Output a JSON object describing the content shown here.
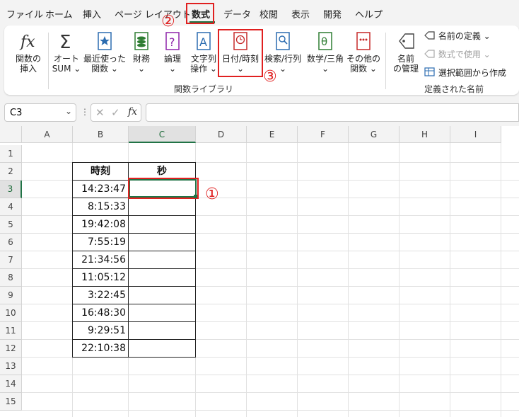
{
  "menu": {
    "tabs": [
      "ファイル",
      "ホーム",
      "挿入",
      "ページ レイアウト",
      "数式",
      "データ",
      "校閲",
      "表示",
      "開発",
      "ヘルプ"
    ],
    "active_tab": "数式"
  },
  "ribbon": {
    "insert_function": [
      "関数の",
      "挿入"
    ],
    "autosum": [
      "オート",
      "SUM ⌄"
    ],
    "recent": [
      "最近使った",
      "関数 ⌄"
    ],
    "financial": [
      "財務",
      "⌄"
    ],
    "logical": [
      "論理",
      "⌄"
    ],
    "text": [
      "文字列",
      "操作 ⌄"
    ],
    "datetime": [
      "日付/時刻",
      "⌄"
    ],
    "lookup": [
      "検索/行列",
      "⌄"
    ],
    "math": [
      "数学/三角",
      "⌄"
    ],
    "more": [
      "その他の",
      "関数 ⌄"
    ],
    "name_manager": [
      "名前",
      "の管理"
    ],
    "define_name": "名前の定義 ⌄",
    "use_in_formula": "数式で使用 ⌄",
    "create_from_selection": "選択範囲から作成",
    "group_library": "関数ライブラリ",
    "group_names": "定義された名前"
  },
  "formula_bar": {
    "name_box": "C3",
    "fx": "fx",
    "value": ""
  },
  "grid": {
    "columns": [
      "A",
      "B",
      "C",
      "D",
      "E",
      "F",
      "G",
      "H",
      "I"
    ],
    "rows": [
      "1",
      "2",
      "3",
      "4",
      "5",
      "6",
      "7",
      "8",
      "9",
      "10",
      "11",
      "12",
      "13",
      "14",
      "15"
    ],
    "headers": {
      "B": "時刻",
      "C": "秒"
    },
    "times": [
      "14:23:47",
      "8:15:33",
      "19:42:08",
      "7:55:19",
      "21:34:56",
      "11:05:12",
      "3:22:45",
      "16:48:30",
      "9:29:51",
      "22:10:38"
    ],
    "selected_cell": "C3"
  },
  "annotations": {
    "step1": "①",
    "step2": "②",
    "step3": "③"
  },
  "colors": {
    "accent_green": "#217346",
    "annotation_red": "#e02020"
  }
}
